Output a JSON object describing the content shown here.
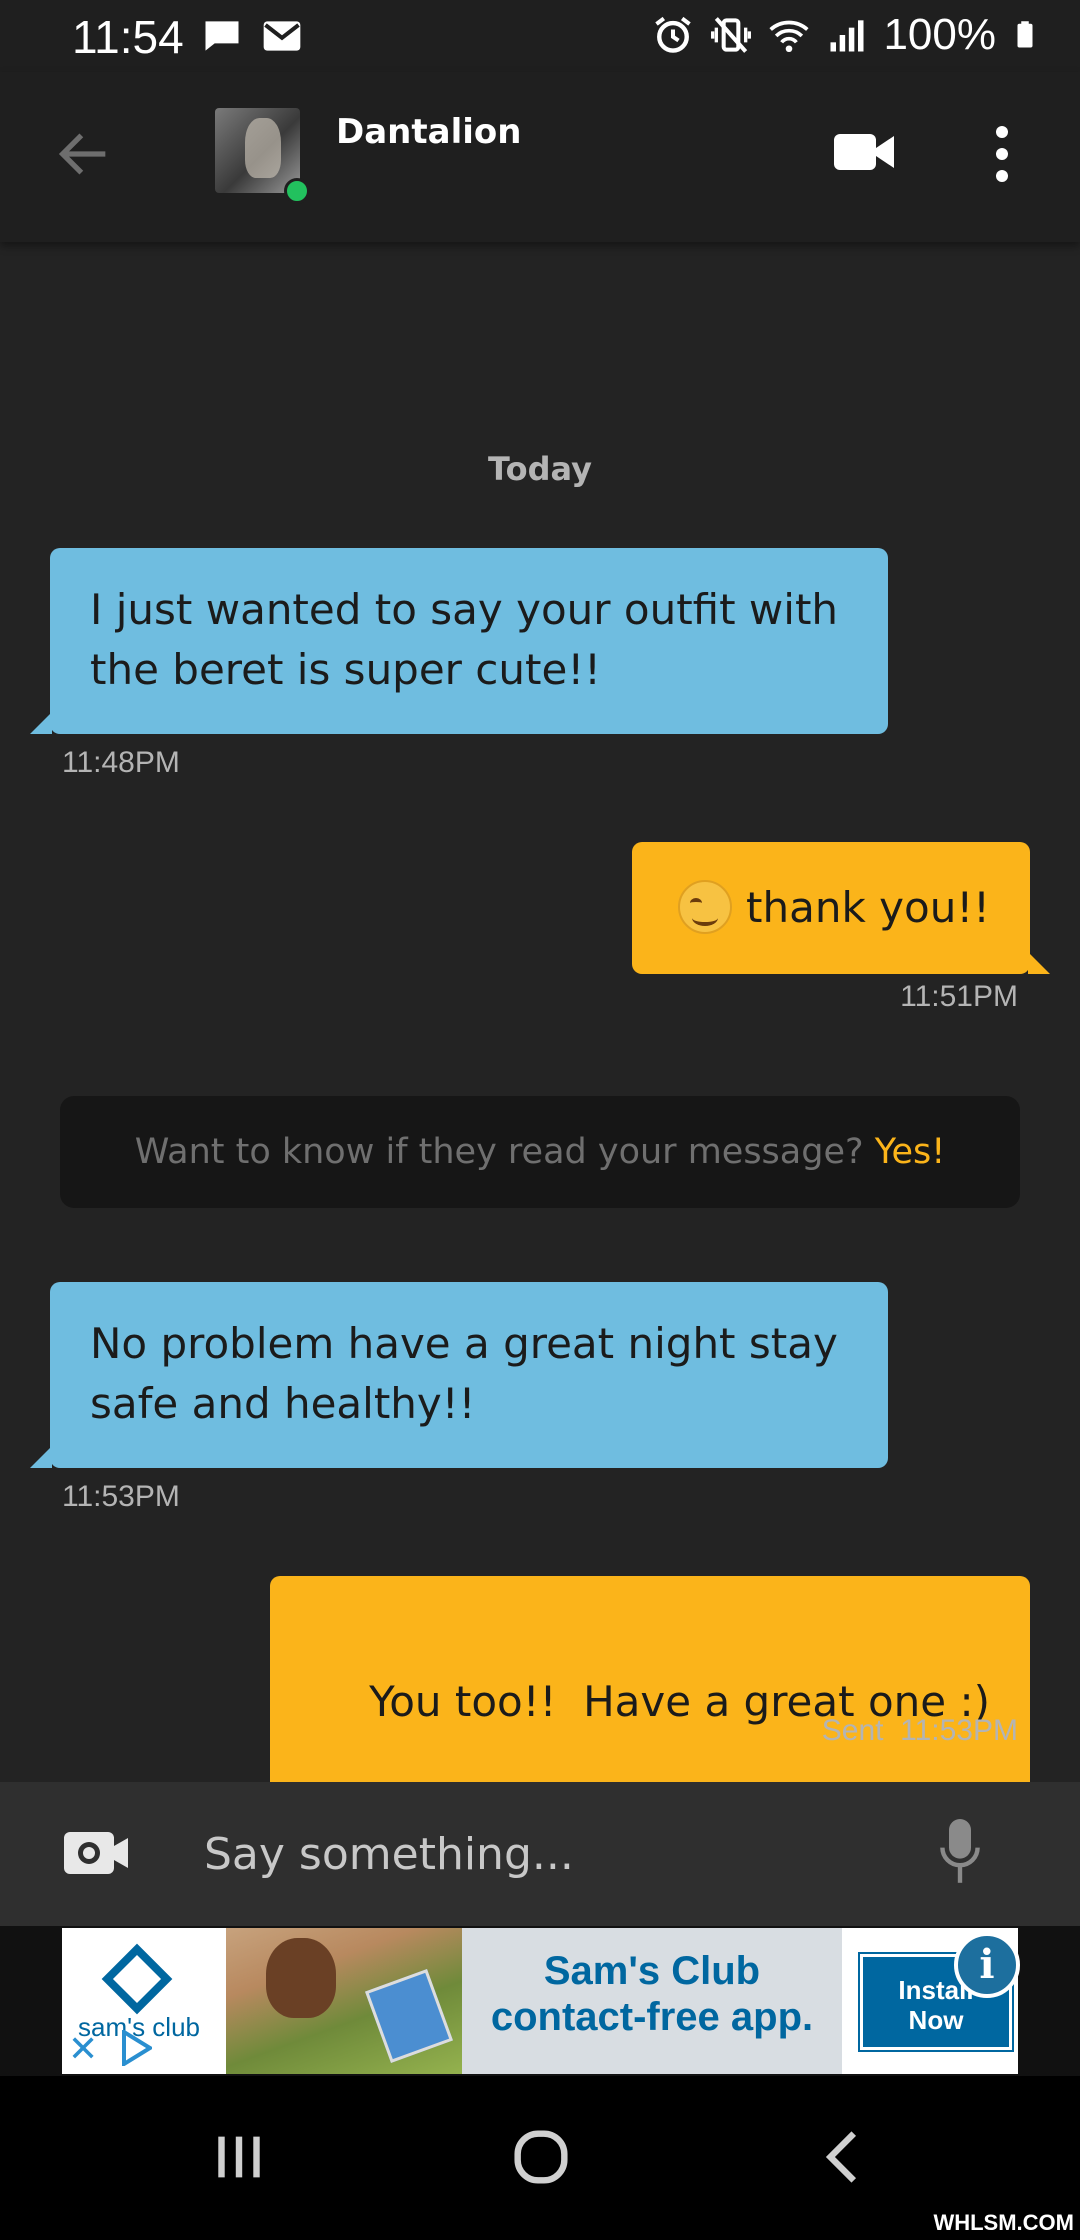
{
  "status_bar": {
    "time": "11:54",
    "battery": "100%",
    "left_icons": [
      "message-icon",
      "mail-icon"
    ],
    "right_icons": [
      "alarm-icon",
      "vibrate-icon",
      "wifi-icon",
      "signal-icon",
      "battery-icon"
    ]
  },
  "header": {
    "contact_name": "Dantalion",
    "online": true,
    "actions": [
      "back-arrow-icon",
      "video-call-icon",
      "more-vert-icon"
    ]
  },
  "chat": {
    "date_separator": "Today",
    "messages": [
      {
        "direction": "incoming",
        "text": "I just wanted to say your outfit with the beret is super cute!!",
        "time": "11:48PM"
      },
      {
        "direction": "outgoing",
        "emoji": "smiling-face-icon",
        "text": "thank you!!",
        "time": "11:51PM"
      },
      {
        "direction": "incoming",
        "text": "No problem have a great night stay safe and healthy!!",
        "time": "11:53PM"
      },
      {
        "direction": "outgoing",
        "text": "You too!!  Have a great one :)",
        "time": "Sent  11:53PM"
      }
    ],
    "read_receipt_banner": {
      "question": "Want to know if they read your message?",
      "cta": "Yes!"
    }
  },
  "input_bar": {
    "placeholder": "Say something..."
  },
  "ad": {
    "brand": "sam's club",
    "headline_line1": "Sam's Club",
    "headline_line2": "contact-free app.",
    "cta_line1": "Install",
    "cta_line2": "Now",
    "info_glyph": "i",
    "close_glyph": "✕"
  },
  "watermark": "WHLSM.COM",
  "colors": {
    "incoming_bubble": "#6fbde0",
    "outgoing_bubble": "#fbb41a",
    "background": "#232323",
    "online_dot": "#22c15e",
    "ad_brand_blue": "#0067a0"
  }
}
